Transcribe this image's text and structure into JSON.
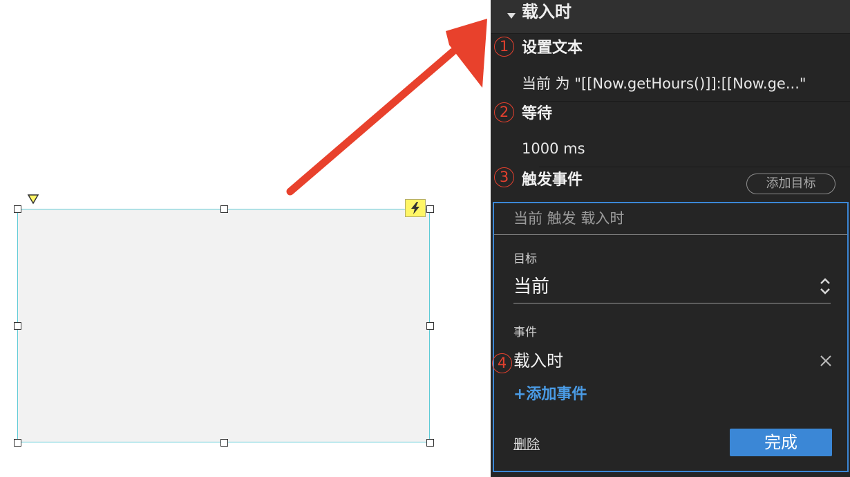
{
  "canvas": {
    "colors": {
      "shape_fill": "#f2f2f2",
      "shape_border": "#5ecbd6",
      "arrow": "#e8412c",
      "bolt_badge": "#fff666"
    }
  },
  "panel": {
    "section_title": "载入时",
    "actions": [
      {
        "number": "1",
        "title": "设置文本",
        "detail": "当前 为 \"[[Now.getHours()]]:[[Now.ge...\""
      },
      {
        "number": "2",
        "title": "等待",
        "detail": "1000 ms"
      },
      {
        "number": "3",
        "title": "触发事件",
        "detail": ""
      }
    ],
    "add_target_label": "添加目标",
    "event_editor": {
      "summary": "当前 触发 载入时",
      "target_label": "目标",
      "target_value": "当前",
      "event_label": "事件",
      "event_number": "4",
      "event_value": "载入时",
      "add_event_label": "+添加事件",
      "delete_label": "删除",
      "done_label": "完成"
    },
    "colors": {
      "background": "#252525",
      "accent": "#3b87d6",
      "annotation": "#e2402e",
      "link": "#4a9be5"
    }
  }
}
